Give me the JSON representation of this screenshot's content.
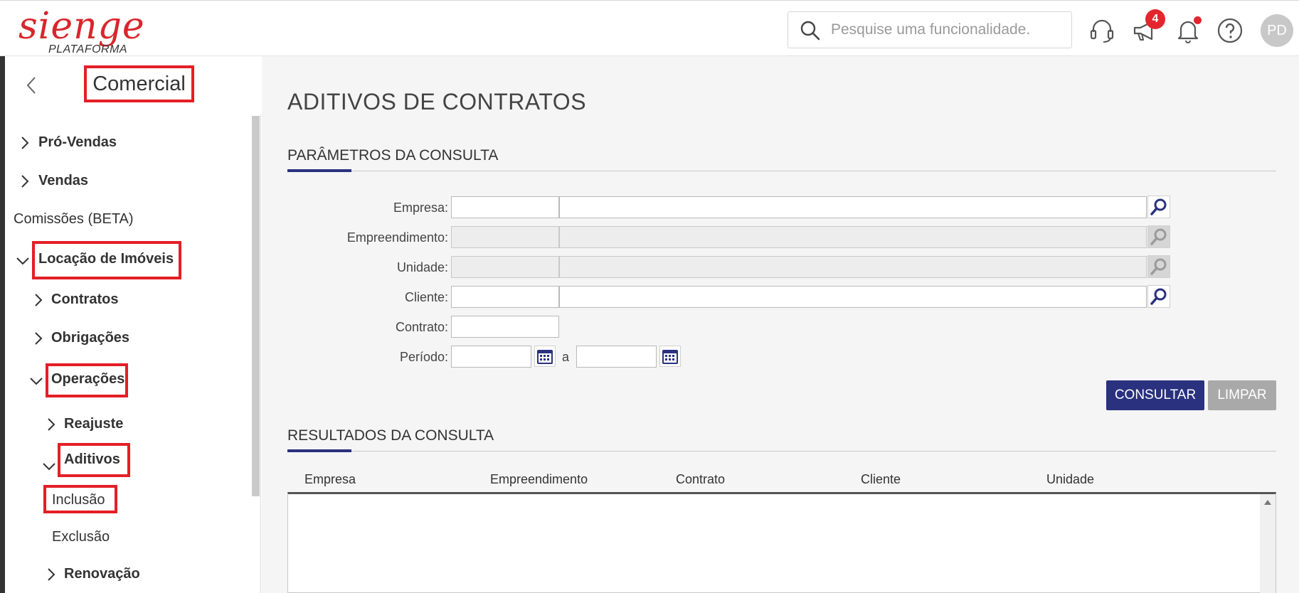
{
  "header": {
    "logo_text": "sienge",
    "logo_sub": "PLATAFORMA",
    "search_placeholder": "Pesquise uma funcionalidade.",
    "notification_count": "4",
    "avatar_initials": "PD"
  },
  "sidebar": {
    "title": "Comercial",
    "items": [
      {
        "label": "Pró-Vendas"
      },
      {
        "label": "Vendas"
      },
      {
        "label": "Comissões (BETA)"
      },
      {
        "label": "Locação de Imóveis"
      },
      {
        "label": "Contratos"
      },
      {
        "label": "Obrigações"
      },
      {
        "label": "Operações"
      },
      {
        "label": "Reajuste"
      },
      {
        "label": "Aditivos"
      },
      {
        "label": "Inclusão"
      },
      {
        "label": "Exclusão"
      },
      {
        "label": "Renovação"
      }
    ]
  },
  "main": {
    "title": "ADITIVOS DE CONTRATOS",
    "params_section": "PARÂMETROS DA CONSULTA",
    "fields": {
      "empresa": "Empresa:",
      "empreendimento": "Empreendimento:",
      "unidade": "Unidade:",
      "cliente": "Cliente:",
      "contrato": "Contrato:",
      "periodo": "Período:",
      "periodo_sep": "a"
    },
    "buttons": {
      "consultar": "CONSULTAR",
      "limpar": "LIMPAR"
    },
    "results_section": "RESULTADOS DA CONSULTA",
    "columns": [
      "Empresa",
      "Empreendimento",
      "Contrato",
      "Cliente",
      "Unidade"
    ]
  },
  "colors": {
    "brand_red": "#d8262c",
    "highlight_red": "#e41e26",
    "primary_blue": "#2a317f",
    "button_grey": "#a9a9a9"
  }
}
